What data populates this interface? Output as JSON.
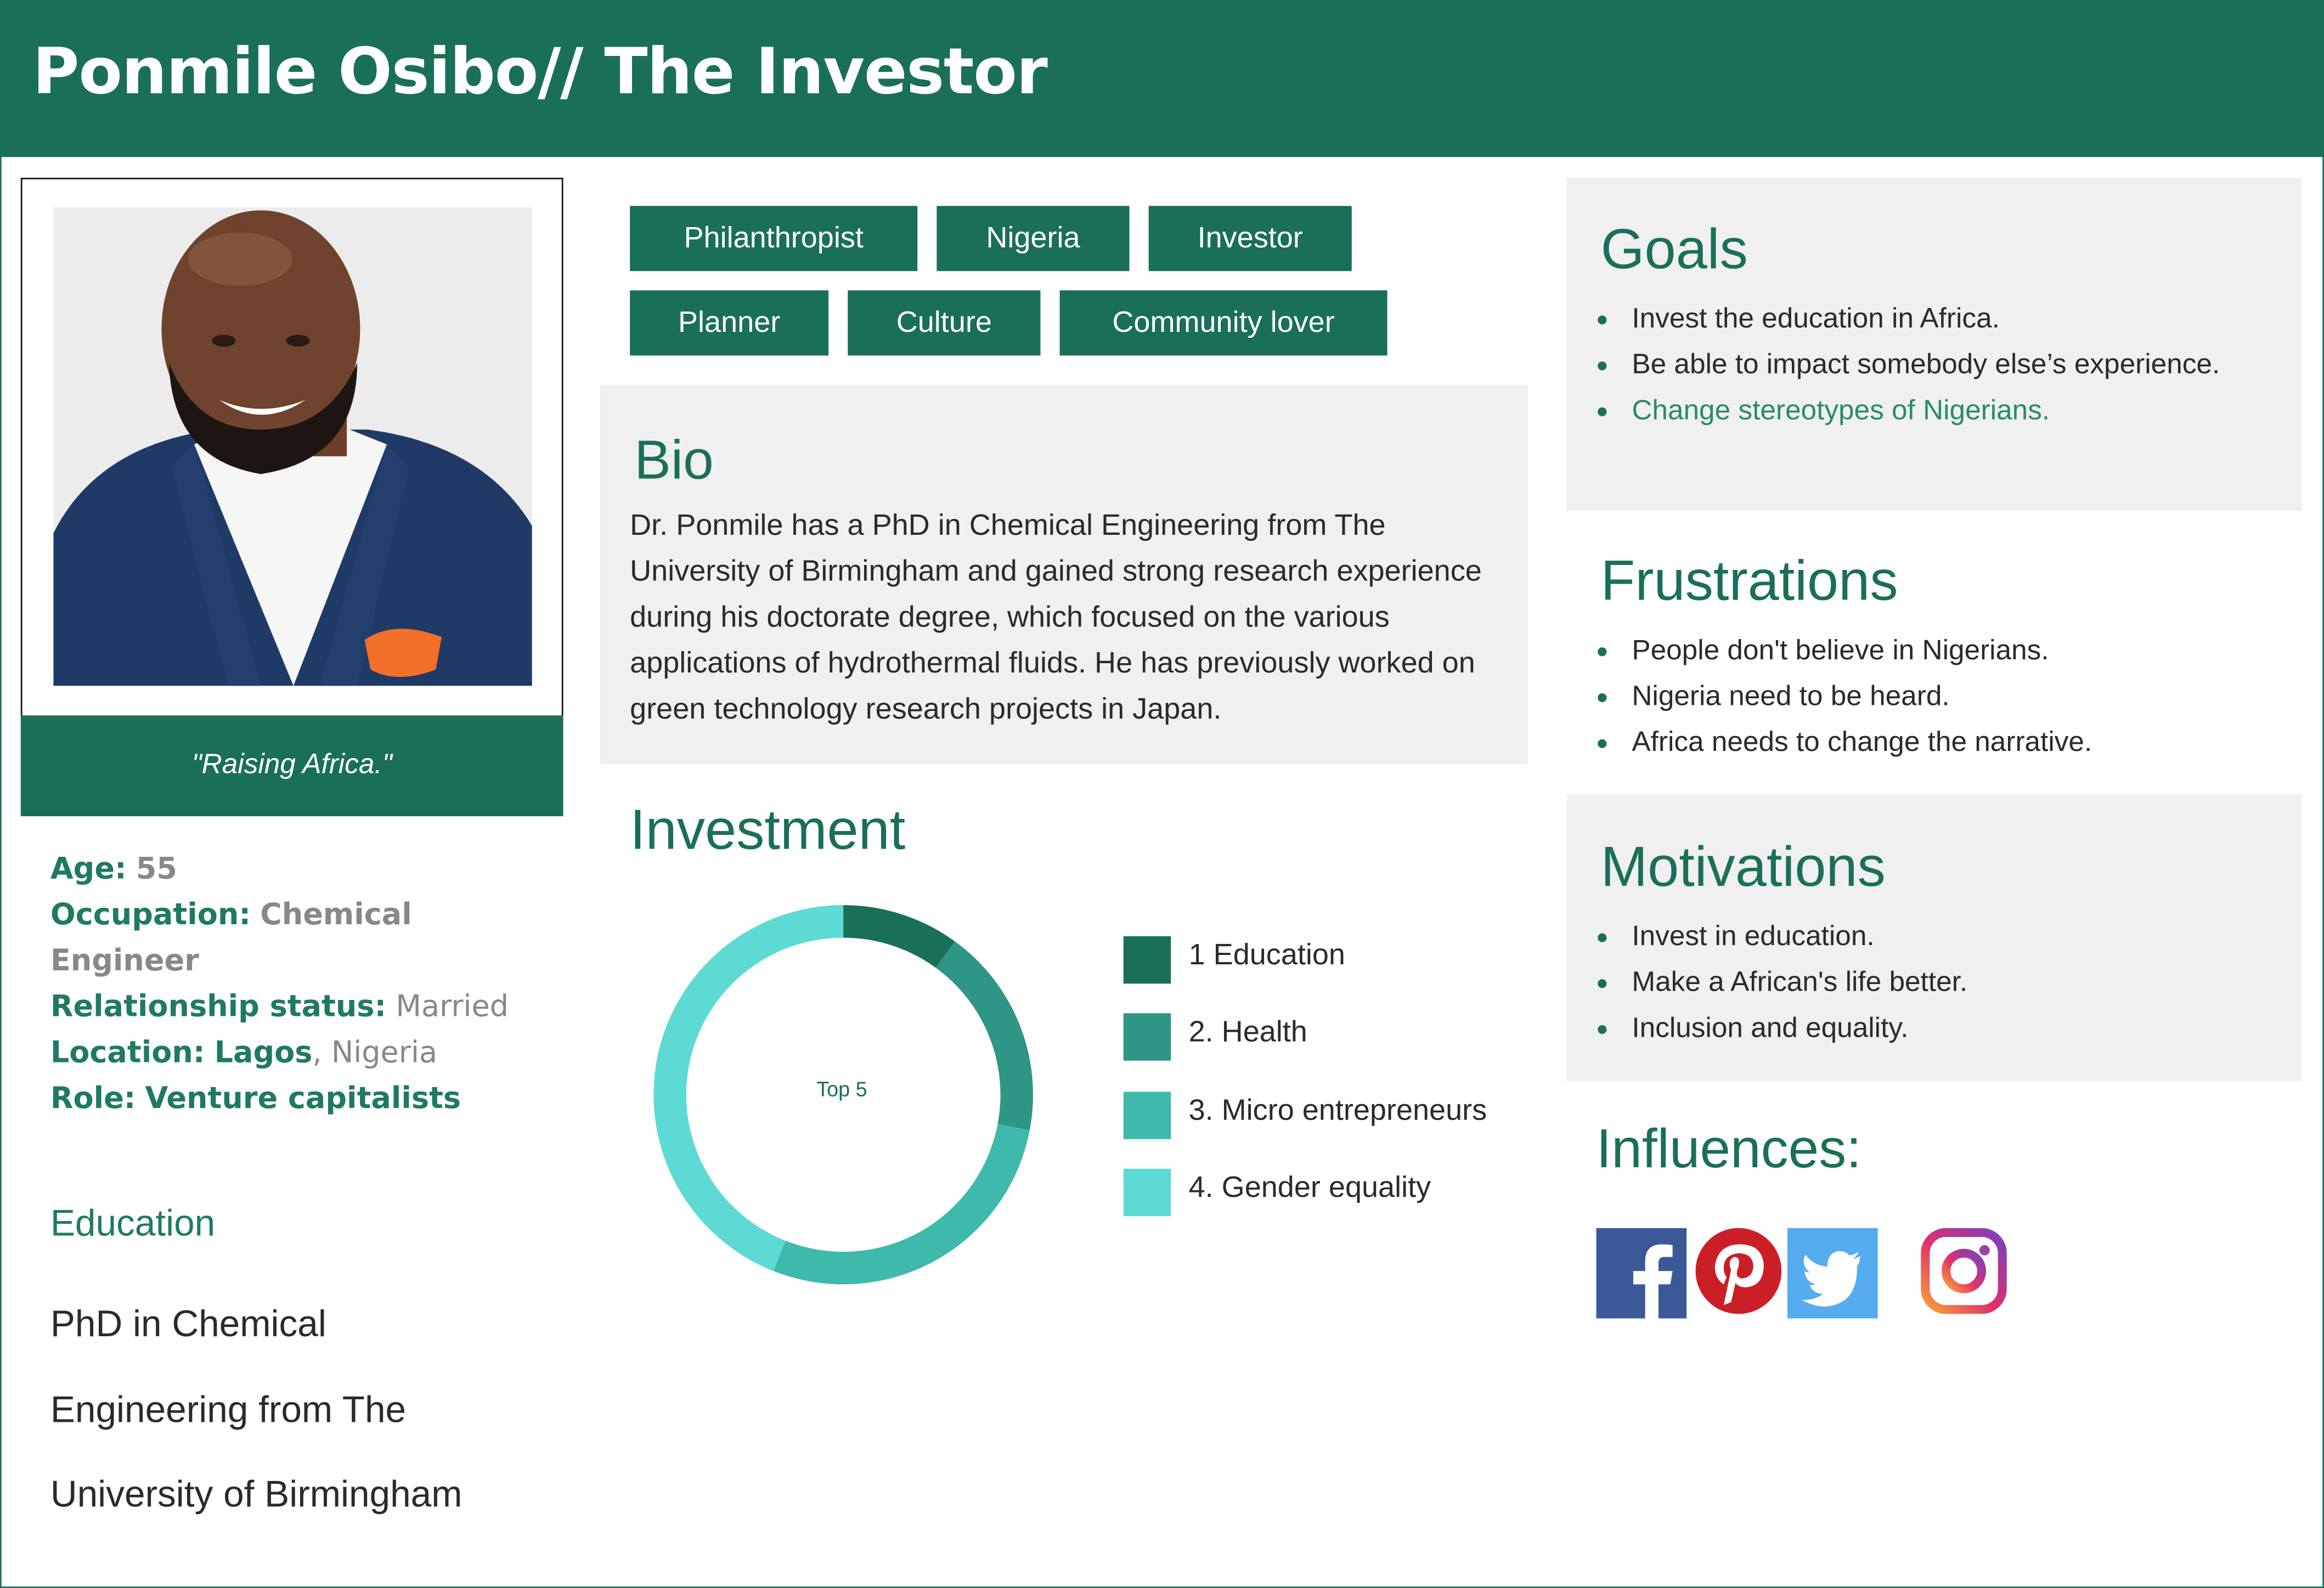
{
  "header": {
    "title": "Ponmile Osibo// The Investor"
  },
  "profile": {
    "quote": "\"Raising Africa.\"",
    "age_label": "Age:",
    "age_value": "55",
    "occupation_label": "Occupation:",
    "occupation_value_1": "Chemical",
    "occupation_value_2": "Engineer",
    "relationship_label": "Relationship status:",
    "relationship_value": "Married",
    "location_label": "Location:",
    "location_city": "Lagos",
    "location_country": ", Nigeria",
    "role_label": "Role:",
    "role_value": "Venture capitalists",
    "education_title": "Education",
    "education_lines": [
      "PhD in Chemical",
      "Engineering from The",
      "University of Birmingham"
    ]
  },
  "tags": [
    "Philanthropist",
    "Nigeria",
    "Investor",
    "Planner",
    "Culture",
    "Community lover"
  ],
  "bio": {
    "title": "Bio",
    "text": "Dr. Ponmile has a PhD in Chemical Engineering from The University of Birmingham and gained strong research experience during his doctorate degree, which focused on the various applications of hydrothermal fluids. He has previously worked on green technology research projects in Japan."
  },
  "investment": {
    "title": "Investment",
    "center_label": "Top 5"
  },
  "chart_data": {
    "type": "pie",
    "style": "donut",
    "center_label": "Top 5",
    "categories": [
      "1 Education",
      "2. Health",
      "3. Micro entrepreneurs",
      "4. Gender equality"
    ],
    "values": [
      10,
      18,
      28,
      44
    ],
    "colors": [
      "#1a6f58",
      "#2e9684",
      "#3fb9ab",
      "#5cdad3"
    ]
  },
  "goals": {
    "title": "Goals",
    "items": [
      "Invest the education in Africa.",
      "Be able to impact somebody else’s experience.",
      "Change stereotypes of Nigerians."
    ]
  },
  "frustrations": {
    "title": "Frustrations",
    "items": [
      "People don't believe in Nigerians.",
      "Nigeria need to be heard.",
      "Africa needs to change the narrative."
    ]
  },
  "motivations": {
    "title": "Motivations",
    "items": [
      "Invest in education.",
      "Make a African's life better.",
      "Inclusion and equality."
    ]
  },
  "influences": {
    "title": "Influences:",
    "icons": [
      "facebook-icon",
      "pinterest-icon",
      "twitter-icon",
      "instagram-icon"
    ]
  },
  "colors": {
    "primary": "#1a6f58",
    "panel": "#f0f0f0"
  }
}
